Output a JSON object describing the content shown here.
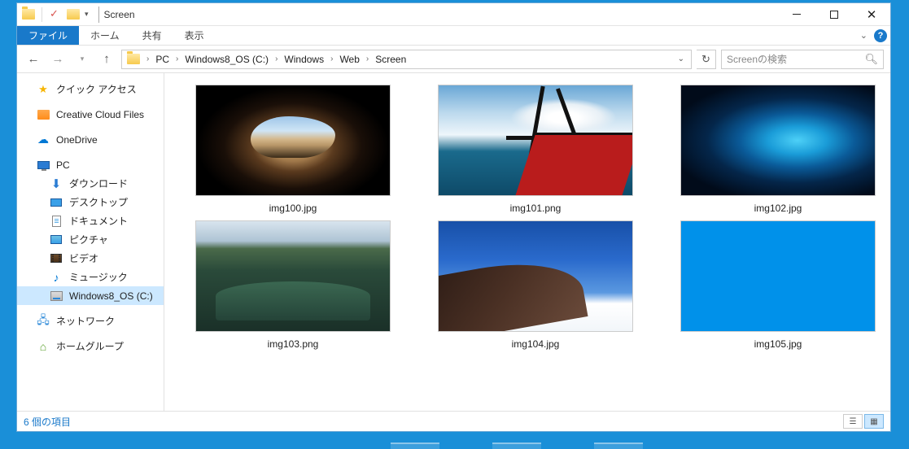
{
  "window": {
    "title": "Screen"
  },
  "ribbon": {
    "file_tab": "ファイル",
    "tabs": [
      "ホーム",
      "共有",
      "表示"
    ]
  },
  "breadcrumb": {
    "segments": [
      "PC",
      "Windows8_OS (C:)",
      "Windows",
      "Web",
      "Screen"
    ]
  },
  "search": {
    "placeholder": "Screenの検索"
  },
  "sidebar": {
    "quick_access": "クイック アクセス",
    "creative_cloud": "Creative Cloud Files",
    "onedrive": "OneDrive",
    "pc": "PC",
    "pc_children": {
      "downloads": "ダウンロード",
      "desktop": "デスクトップ",
      "documents": "ドキュメント",
      "pictures": "ピクチャ",
      "videos": "ビデオ",
      "music": "ミュージック",
      "disk": "Windows8_OS (C:)"
    },
    "network": "ネットワーク",
    "homegroup": "ホームグループ"
  },
  "files": {
    "f1": "img100.jpg",
    "f2": "img101.png",
    "f3": "img102.jpg",
    "f4": "img103.png",
    "f5": "img104.jpg",
    "f6": "img105.jpg"
  },
  "status": {
    "item_count": "6 個の項目"
  }
}
